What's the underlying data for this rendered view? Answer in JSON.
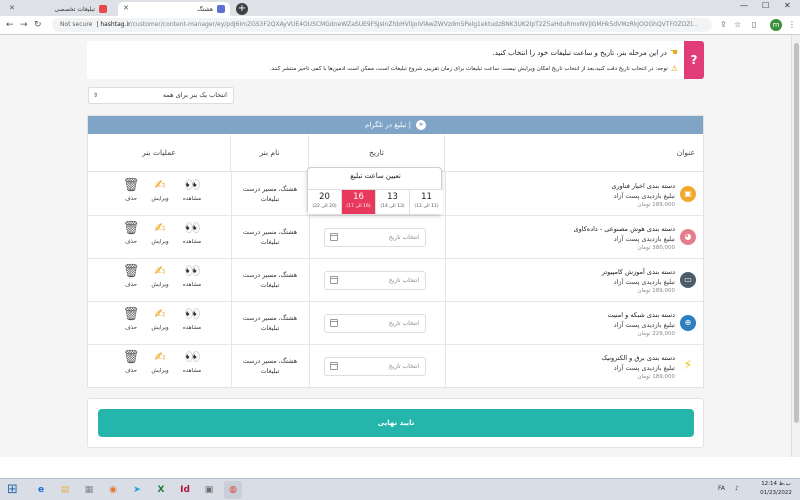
{
  "browser": {
    "tabs": [
      {
        "label": "تبلیغات تخصصی",
        "favicon_color": "#e84a4a",
        "active": false
      },
      {
        "label": "هشتگ",
        "favicon_color": "#5b6fd6",
        "active": true
      }
    ],
    "new_tab": "+",
    "address": {
      "security_label": "Not secure",
      "host": "hashtag.ir",
      "path": "/customer/content-manager/ey/pdJ6ImZGS3F2QXAyVUE4OUSCMGdneWZaSUE9FSJsInZhbHVlIjoiVlAwZWVzdm5Pelg1ektudzBNK3UK2lpT2Z5aHduRmxNVjlGMHk5dVMzRkJOOGhQVTFOZDZl..."
    },
    "window_controls": [
      "—",
      "☐",
      "✕"
    ],
    "profile_initial": "m"
  },
  "notice": {
    "help_symbol": "?",
    "line1": "در این مرحله بنر، تاریخ و ساعت تبلیغات خود را انتخاب کنید.",
    "line2": "توجه: در انتخاب تاریخ دقت کنید،بعد از انتخاب تاریخ امکان ویرایش نیست. ساعت تبلیغات برای زمان تقریبی شروع تبلیغات است، ممکن است ادمین‌ها با کمی تاخیر منتشر کنند."
  },
  "banner_select": {
    "value": "انتخاب یک بنر برای همه",
    "arrow": "⇕"
  },
  "card": {
    "title": "تبلیغ در تلگرام  |",
    "columns": {
      "title": "عنوان",
      "date": "تاریخ",
      "banner_name": "نام بنر",
      "ops": "عملیات بنر"
    }
  },
  "rows": [
    {
      "title": "دسته بندی اخبار فناوری",
      "subtitle": "تبلیغ بازدیدی پست آزاد",
      "price": "189,000 تومان",
      "icon_color": "#f0a82c",
      "date_placeholder": "انتخاب تاریخ",
      "banner_name_line1": "هشتگ، مسیر درست",
      "banner_name_line2": "تبلیغات",
      "view_label": "مشاهده",
      "edit_label": "ویرایش",
      "delete_label": "حذف"
    },
    {
      "title": "دسته بندی هوش مصنوعی - داده‌کاوی",
      "subtitle": "تبلیغ بازدیدی پست آزاد",
      "price": "380,000 تومان",
      "icon_color": "#e67d8c",
      "date_placeholder": "انتخاب تاریخ",
      "banner_name_line1": "هشتگ، مسیر درست",
      "banner_name_line2": "تبلیغات",
      "view_label": "مشاهده",
      "edit_label": "ویرایش",
      "delete_label": "حذف"
    },
    {
      "title": "دسته بندی آموزش کامپیوتر",
      "subtitle": "تبلیغ بازدیدی پست آزاد",
      "price": "189,000 تومان",
      "icon_color": "#4d5b6b",
      "date_placeholder": "انتخاب تاریخ",
      "banner_name_line1": "هشتگ، مسیر درست",
      "banner_name_line2": "تبلیغات",
      "view_label": "مشاهده",
      "edit_label": "ویرایش",
      "delete_label": "حذف"
    },
    {
      "title": "دسته بندی شبکه و امنیت",
      "subtitle": "تبلیغ بازدیدی پست آزاد",
      "price": "229,000 تومان",
      "icon_color": "#2b7fc0",
      "date_placeholder": "انتخاب تاریخ",
      "banner_name_line1": "هشتگ، مسیر درست",
      "banner_name_line2": "تبلیغات",
      "view_label": "مشاهده",
      "edit_label": "ویرایش",
      "delete_label": "حذف"
    },
    {
      "title": "دسته بندی برق و الکترونیک",
      "subtitle": "تبلیغ بازدیدی پست آزاد",
      "price": "189,000 تومان",
      "icon_color": "#f2c419",
      "date_placeholder": "انتخاب تاریخ",
      "banner_name_line1": "هشتگ، مسیر درست",
      "banner_name_line2": "تبلیغات",
      "view_label": "مشاهده",
      "edit_label": "ویرایش",
      "delete_label": "حذف"
    }
  ],
  "time_popover": {
    "title": "تعیین ساعت تبلیغ",
    "hours": [
      {
        "hour": "11",
        "sub": "(11 الی 12)",
        "selected": false
      },
      {
        "hour": "13",
        "sub": "(13 الی 14)",
        "selected": false
      },
      {
        "hour": "16",
        "sub": "(16 الی 17)",
        "selected": true
      },
      {
        "hour": "20",
        "sub": "(20 الی 22)",
        "selected": false
      }
    ],
    "clear_symbol": "✕"
  },
  "confirm_label": "تایید نهایی",
  "taskbar": {
    "apps": [
      "e",
      "▤",
      "▦",
      "◉",
      "➤",
      "X",
      "Id",
      "▣",
      "◍"
    ],
    "tray_lang": "FA",
    "clock_time": "12:14 ب.ظ",
    "clock_date": "01/23/2022"
  },
  "colors": {
    "accent_teal": "#26b5aa",
    "header_blue": "#7fa4c6",
    "help_pink": "#e03c78",
    "selected_hour": "#e8395c"
  }
}
